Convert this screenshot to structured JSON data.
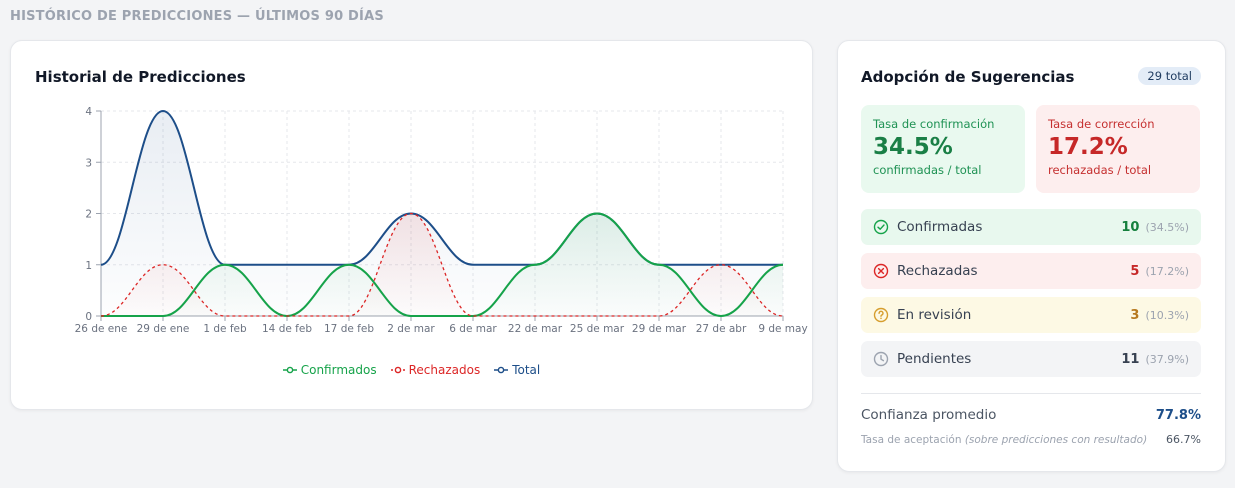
{
  "page": {
    "title": "HISTÓRICO DE PREDICCIONES — ÚLTIMOS 90 DÍAS"
  },
  "history_card": {
    "title": "Historial de Predicciones"
  },
  "chart_data": {
    "type": "line",
    "categories": [
      "26 de ene",
      "29 de ene",
      "1 de feb",
      "14 de feb",
      "17 de feb",
      "2 de mar",
      "6 de mar",
      "22 de mar",
      "25 de mar",
      "29 de mar",
      "27 de abr",
      "9 de may"
    ],
    "series": [
      {
        "name": "Confirmados",
        "color": "#16a34a",
        "style": "solid",
        "values": [
          0,
          0,
          1,
          0,
          1,
          0,
          0,
          1,
          2,
          1,
          0,
          1
        ]
      },
      {
        "name": "Rechazados",
        "color": "#dc2626",
        "style": "dashed",
        "values": [
          0,
          1,
          0,
          0,
          0,
          2,
          0,
          0,
          0,
          0,
          1,
          0
        ]
      },
      {
        "name": "Total",
        "color": "#1d4e89",
        "style": "solid",
        "values": [
          1,
          4,
          1,
          1,
          1,
          2,
          1,
          1,
          2,
          1,
          1,
          1
        ]
      }
    ],
    "y_ticks": [
      0,
      1,
      2,
      3,
      4
    ],
    "ylim": [
      0,
      4
    ],
    "grid": true,
    "legend_position": "bottom"
  },
  "adoption": {
    "title": "Adopción de Sugerencias",
    "total_badge": "29 total",
    "confirm_rate": {
      "label": "Tasa de confirmación",
      "value": "34.5%",
      "sub": "confirmadas / total"
    },
    "correct_rate": {
      "label": "Tasa de corrección",
      "value": "17.2%",
      "sub": "rechazadas / total"
    },
    "stats": {
      "confirmed": {
        "label": "Confirmadas",
        "count": "10",
        "pct": "(34.5%)",
        "icon": "check-circle-icon"
      },
      "rejected": {
        "label": "Rechazadas",
        "count": "5",
        "pct": "(17.2%)",
        "icon": "x-circle-icon"
      },
      "review": {
        "label": "En revisión",
        "count": "3",
        "pct": "(10.3%)",
        "icon": "help-circle-icon"
      },
      "pending": {
        "label": "Pendientes",
        "count": "11",
        "pct": "(37.9%)",
        "icon": "clock-icon"
      }
    },
    "avg_confidence": {
      "label": "Confianza promedio",
      "value": "77.8%"
    },
    "acceptance": {
      "label": "Tasa de aceptación",
      "hint": "(sobre predicciones con resultado)",
      "value": "66.7%"
    }
  }
}
